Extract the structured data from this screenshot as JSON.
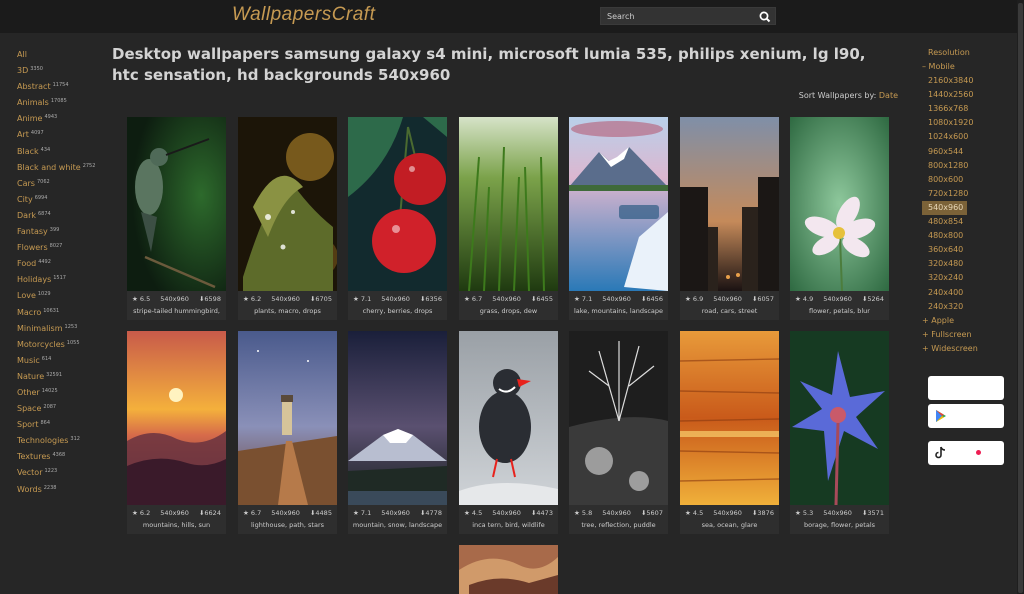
{
  "header": {
    "logo": "WallpapersCraft",
    "search_placeholder": "Search"
  },
  "categories": [
    {
      "label": "All",
      "count": ""
    },
    {
      "label": "3D",
      "count": "3350"
    },
    {
      "label": "Abstract",
      "count": "11754"
    },
    {
      "label": "Animals",
      "count": "17085"
    },
    {
      "label": "Anime",
      "count": "4943"
    },
    {
      "label": "Art",
      "count": "4097"
    },
    {
      "label": "Black",
      "count": "434"
    },
    {
      "label": "Black and white",
      "count": "2752"
    },
    {
      "label": "Cars",
      "count": "7062"
    },
    {
      "label": "City",
      "count": "6994"
    },
    {
      "label": "Dark",
      "count": "6874"
    },
    {
      "label": "Fantasy",
      "count": "399"
    },
    {
      "label": "Flowers",
      "count": "8027"
    },
    {
      "label": "Food",
      "count": "4492"
    },
    {
      "label": "Holidays",
      "count": "1517"
    },
    {
      "label": "Love",
      "count": "1029"
    },
    {
      "label": "Macro",
      "count": "10631"
    },
    {
      "label": "Minimalism",
      "count": "1253"
    },
    {
      "label": "Motorcycles",
      "count": "1055"
    },
    {
      "label": "Music",
      "count": "614"
    },
    {
      "label": "Nature",
      "count": "32591"
    },
    {
      "label": "Other",
      "count": "14025"
    },
    {
      "label": "Space",
      "count": "2087"
    },
    {
      "label": "Sport",
      "count": "864"
    },
    {
      "label": "Technologies",
      "count": "312"
    },
    {
      "label": "Textures",
      "count": "4368"
    },
    {
      "label": "Vector",
      "count": "1223"
    },
    {
      "label": "Words",
      "count": "2238"
    }
  ],
  "page": {
    "title": "Desktop wallpapers samsung galaxy s4 mini, microsoft lumia 535, philips xenium, lg l90, htc sensation, hd backgrounds 540x960",
    "sort_label": "Sort Wallpapers by:",
    "sort_value": "Date"
  },
  "wallpapers": [
    {
      "rating": "6.5",
      "size": "540x960",
      "downloads": "6598",
      "tags": "stripe-tailed hummingbird,"
    },
    {
      "rating": "6.2",
      "size": "540x960",
      "downloads": "6705",
      "tags": "plants, macro, drops"
    },
    {
      "rating": "7.1",
      "size": "540x960",
      "downloads": "6356",
      "tags": "cherry, berries, drops"
    },
    {
      "rating": "6.7",
      "size": "540x960",
      "downloads": "6455",
      "tags": "grass, drops, dew"
    },
    {
      "rating": "7.1",
      "size": "540x960",
      "downloads": "6456",
      "tags": "lake, mountains, landscape"
    },
    {
      "rating": "6.9",
      "size": "540x960",
      "downloads": "6057",
      "tags": "road, cars, street"
    },
    {
      "rating": "4.9",
      "size": "540x960",
      "downloads": "5264",
      "tags": "flower, petals, blur"
    },
    {
      "rating": "6.2",
      "size": "540x960",
      "downloads": "6624",
      "tags": "mountains, hills, sun"
    },
    {
      "rating": "6.7",
      "size": "540x960",
      "downloads": "4485",
      "tags": "lighthouse, path, stars"
    },
    {
      "rating": "7.1",
      "size": "540x960",
      "downloads": "4778",
      "tags": "mountain, snow, landscape"
    },
    {
      "rating": "4.5",
      "size": "540x960",
      "downloads": "4473",
      "tags": "inca tern, bird, wildlife"
    },
    {
      "rating": "5.8",
      "size": "540x960",
      "downloads": "5607",
      "tags": "tree, reflection, puddle"
    },
    {
      "rating": "4.5",
      "size": "540x960",
      "downloads": "3876",
      "tags": "sea, ocean, glare"
    },
    {
      "rating": "5.3",
      "size": "540x960",
      "downloads": "3571",
      "tags": "borage, flower, petals"
    }
  ],
  "resolution": {
    "title": "Resolution",
    "mobile_label": "– Mobile",
    "mobile": [
      "2160x3840",
      "1440x2560",
      "1366x768",
      "1080x1920",
      "1024x600",
      "960x544",
      "800x1280",
      "800x600",
      "720x1280",
      "540x960",
      "480x854",
      "480x800",
      "360x640",
      "320x480",
      "320x240",
      "240x400",
      "240x320"
    ],
    "active": "540x960",
    "others": [
      "+ Apple",
      "+ Fullscreen",
      "+ Widescreen"
    ]
  },
  "icons": {
    "search": "search-icon",
    "rating": "star-icon",
    "downloads": "download-icon",
    "google_play": "google-play-icon",
    "tiktok": "tiktok-icon"
  },
  "colors": {
    "accent": "#c69a52",
    "background": "#262626",
    "header": "#1b1b1b",
    "active": "#7b6238"
  }
}
